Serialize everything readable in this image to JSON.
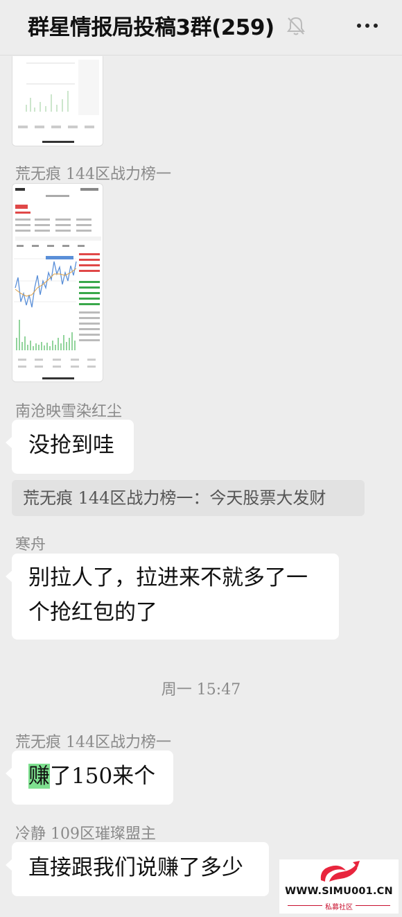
{
  "header": {
    "title": "群星情报局投稿3群(259)",
    "mute_icon": "bell-muted-icon",
    "more_icon": "more-dots-icon"
  },
  "messages": [
    {
      "sender": "荒无痕 144区战力榜一",
      "type": "image"
    },
    {
      "sender": "南沧映雪染红尘",
      "text": "没抢到哇"
    },
    {
      "quote": "荒无痕 144区战力榜一：今天股票大发财"
    },
    {
      "sender": "寒舟",
      "line1": "别拉人了，拉进来不就多了一",
      "line2": "个抢红包的了"
    },
    {
      "time": "周一 15:47"
    },
    {
      "sender": "荒无痕 144区战力榜一",
      "highlight": "赚",
      "rest": "了150来个"
    },
    {
      "sender": "冷静 109区璀璨盟主",
      "text": "直接跟我们说赚了多少"
    }
  ],
  "watermark": {
    "text": "WWW.SIMU001.CN",
    "sub": "私募社区",
    "logo_color": "#e8253d"
  }
}
